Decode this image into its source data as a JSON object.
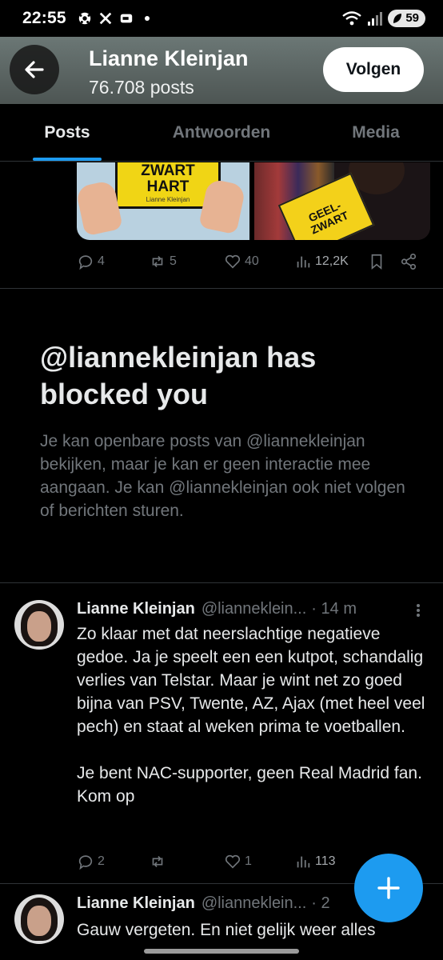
{
  "status_bar": {
    "time": "22:55",
    "battery": "59",
    "icons": [
      "soccer-icon",
      "x-logo-icon",
      "chat-icon",
      "wifi-icon",
      "signal-icon"
    ]
  },
  "header": {
    "name": "Lianne Kleinjan",
    "posts": "76.708 posts",
    "follow_label": "Volgen"
  },
  "tabs": [
    {
      "label": "Posts",
      "active": true
    },
    {
      "label": "Antwoorden",
      "active": false
    },
    {
      "label": "Media",
      "active": false
    }
  ],
  "media_post": {
    "book_title": "ZWART\nHART",
    "book_author": "Lianne Kleinjan",
    "book2_title": "GEEL-\nZWART",
    "replies": "4",
    "reposts": "5",
    "likes": "40",
    "views": "12,2K"
  },
  "blocked": {
    "title": "@liannekleinjan has blocked you",
    "description": "Je kan openbare posts van @liannekleinjan bekijken, maar je kan er geen interactie mee aangaan. Je kan @liannekleinjan ook niet volgen of berichten sturen."
  },
  "tweets": [
    {
      "name": "Lianne Kleinjan",
      "handle": "@lianneklein...",
      "time": "· 14 m",
      "body": "Zo klaar met dat neerslachtige negatieve gedoe. Ja je speelt een een kutpot, schandalig verlies van Telstar. Maar je wint net zo goed bijna van PSV, Twente, AZ, Ajax (met heel veel pech) en staat al weken prima te voetballen.\n\nJe bent NAC-supporter, geen Real Madrid fan. Kom op",
      "replies": "2",
      "reposts": "",
      "likes": "1",
      "views": "113"
    },
    {
      "name": "Lianne Kleinjan",
      "handle": "@lianneklein...",
      "time": "· 2",
      "body": "Gauw vergeten. En niet gelijk weer alles"
    }
  ],
  "colors": {
    "accent": "#1d9bf0",
    "background": "#000000",
    "muted_text": "#71767b"
  }
}
